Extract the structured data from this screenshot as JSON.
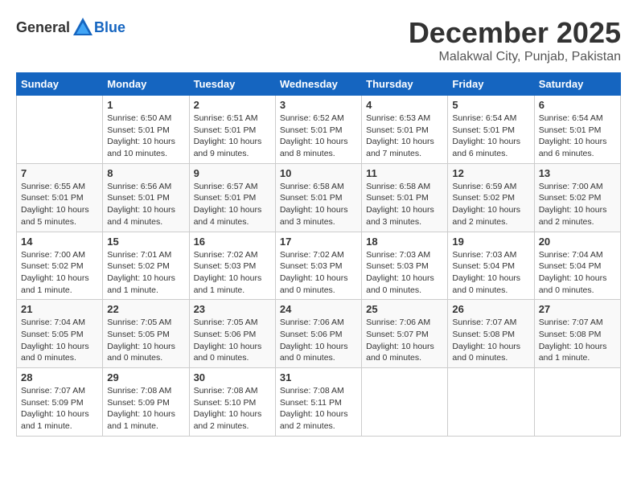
{
  "logo": {
    "general": "General",
    "blue": "Blue"
  },
  "title": "December 2025",
  "location": "Malakwal City, Punjab, Pakistan",
  "days_of_week": [
    "Sunday",
    "Monday",
    "Tuesday",
    "Wednesday",
    "Thursday",
    "Friday",
    "Saturday"
  ],
  "weeks": [
    [
      {
        "day": "",
        "info": ""
      },
      {
        "day": "1",
        "info": "Sunrise: 6:50 AM\nSunset: 5:01 PM\nDaylight: 10 hours\nand 10 minutes."
      },
      {
        "day": "2",
        "info": "Sunrise: 6:51 AM\nSunset: 5:01 PM\nDaylight: 10 hours\nand 9 minutes."
      },
      {
        "day": "3",
        "info": "Sunrise: 6:52 AM\nSunset: 5:01 PM\nDaylight: 10 hours\nand 8 minutes."
      },
      {
        "day": "4",
        "info": "Sunrise: 6:53 AM\nSunset: 5:01 PM\nDaylight: 10 hours\nand 7 minutes."
      },
      {
        "day": "5",
        "info": "Sunrise: 6:54 AM\nSunset: 5:01 PM\nDaylight: 10 hours\nand 6 minutes."
      },
      {
        "day": "6",
        "info": "Sunrise: 6:54 AM\nSunset: 5:01 PM\nDaylight: 10 hours\nand 6 minutes."
      }
    ],
    [
      {
        "day": "7",
        "info": "Sunrise: 6:55 AM\nSunset: 5:01 PM\nDaylight: 10 hours\nand 5 minutes."
      },
      {
        "day": "8",
        "info": "Sunrise: 6:56 AM\nSunset: 5:01 PM\nDaylight: 10 hours\nand 4 minutes."
      },
      {
        "day": "9",
        "info": "Sunrise: 6:57 AM\nSunset: 5:01 PM\nDaylight: 10 hours\nand 4 minutes."
      },
      {
        "day": "10",
        "info": "Sunrise: 6:58 AM\nSunset: 5:01 PM\nDaylight: 10 hours\nand 3 minutes."
      },
      {
        "day": "11",
        "info": "Sunrise: 6:58 AM\nSunset: 5:01 PM\nDaylight: 10 hours\nand 3 minutes."
      },
      {
        "day": "12",
        "info": "Sunrise: 6:59 AM\nSunset: 5:02 PM\nDaylight: 10 hours\nand 2 minutes."
      },
      {
        "day": "13",
        "info": "Sunrise: 7:00 AM\nSunset: 5:02 PM\nDaylight: 10 hours\nand 2 minutes."
      }
    ],
    [
      {
        "day": "14",
        "info": "Sunrise: 7:00 AM\nSunset: 5:02 PM\nDaylight: 10 hours\nand 1 minute."
      },
      {
        "day": "15",
        "info": "Sunrise: 7:01 AM\nSunset: 5:02 PM\nDaylight: 10 hours\nand 1 minute."
      },
      {
        "day": "16",
        "info": "Sunrise: 7:02 AM\nSunset: 5:03 PM\nDaylight: 10 hours\nand 1 minute."
      },
      {
        "day": "17",
        "info": "Sunrise: 7:02 AM\nSunset: 5:03 PM\nDaylight: 10 hours\nand 0 minutes."
      },
      {
        "day": "18",
        "info": "Sunrise: 7:03 AM\nSunset: 5:03 PM\nDaylight: 10 hours\nand 0 minutes."
      },
      {
        "day": "19",
        "info": "Sunrise: 7:03 AM\nSunset: 5:04 PM\nDaylight: 10 hours\nand 0 minutes."
      },
      {
        "day": "20",
        "info": "Sunrise: 7:04 AM\nSunset: 5:04 PM\nDaylight: 10 hours\nand 0 minutes."
      }
    ],
    [
      {
        "day": "21",
        "info": "Sunrise: 7:04 AM\nSunset: 5:05 PM\nDaylight: 10 hours\nand 0 minutes."
      },
      {
        "day": "22",
        "info": "Sunrise: 7:05 AM\nSunset: 5:05 PM\nDaylight: 10 hours\nand 0 minutes."
      },
      {
        "day": "23",
        "info": "Sunrise: 7:05 AM\nSunset: 5:06 PM\nDaylight: 10 hours\nand 0 minutes."
      },
      {
        "day": "24",
        "info": "Sunrise: 7:06 AM\nSunset: 5:06 PM\nDaylight: 10 hours\nand 0 minutes."
      },
      {
        "day": "25",
        "info": "Sunrise: 7:06 AM\nSunset: 5:07 PM\nDaylight: 10 hours\nand 0 minutes."
      },
      {
        "day": "26",
        "info": "Sunrise: 7:07 AM\nSunset: 5:08 PM\nDaylight: 10 hours\nand 0 minutes."
      },
      {
        "day": "27",
        "info": "Sunrise: 7:07 AM\nSunset: 5:08 PM\nDaylight: 10 hours\nand 1 minute."
      }
    ],
    [
      {
        "day": "28",
        "info": "Sunrise: 7:07 AM\nSunset: 5:09 PM\nDaylight: 10 hours\nand 1 minute."
      },
      {
        "day": "29",
        "info": "Sunrise: 7:08 AM\nSunset: 5:09 PM\nDaylight: 10 hours\nand 1 minute."
      },
      {
        "day": "30",
        "info": "Sunrise: 7:08 AM\nSunset: 5:10 PM\nDaylight: 10 hours\nand 2 minutes."
      },
      {
        "day": "31",
        "info": "Sunrise: 7:08 AM\nSunset: 5:11 PM\nDaylight: 10 hours\nand 2 minutes."
      },
      {
        "day": "",
        "info": ""
      },
      {
        "day": "",
        "info": ""
      },
      {
        "day": "",
        "info": ""
      }
    ]
  ]
}
